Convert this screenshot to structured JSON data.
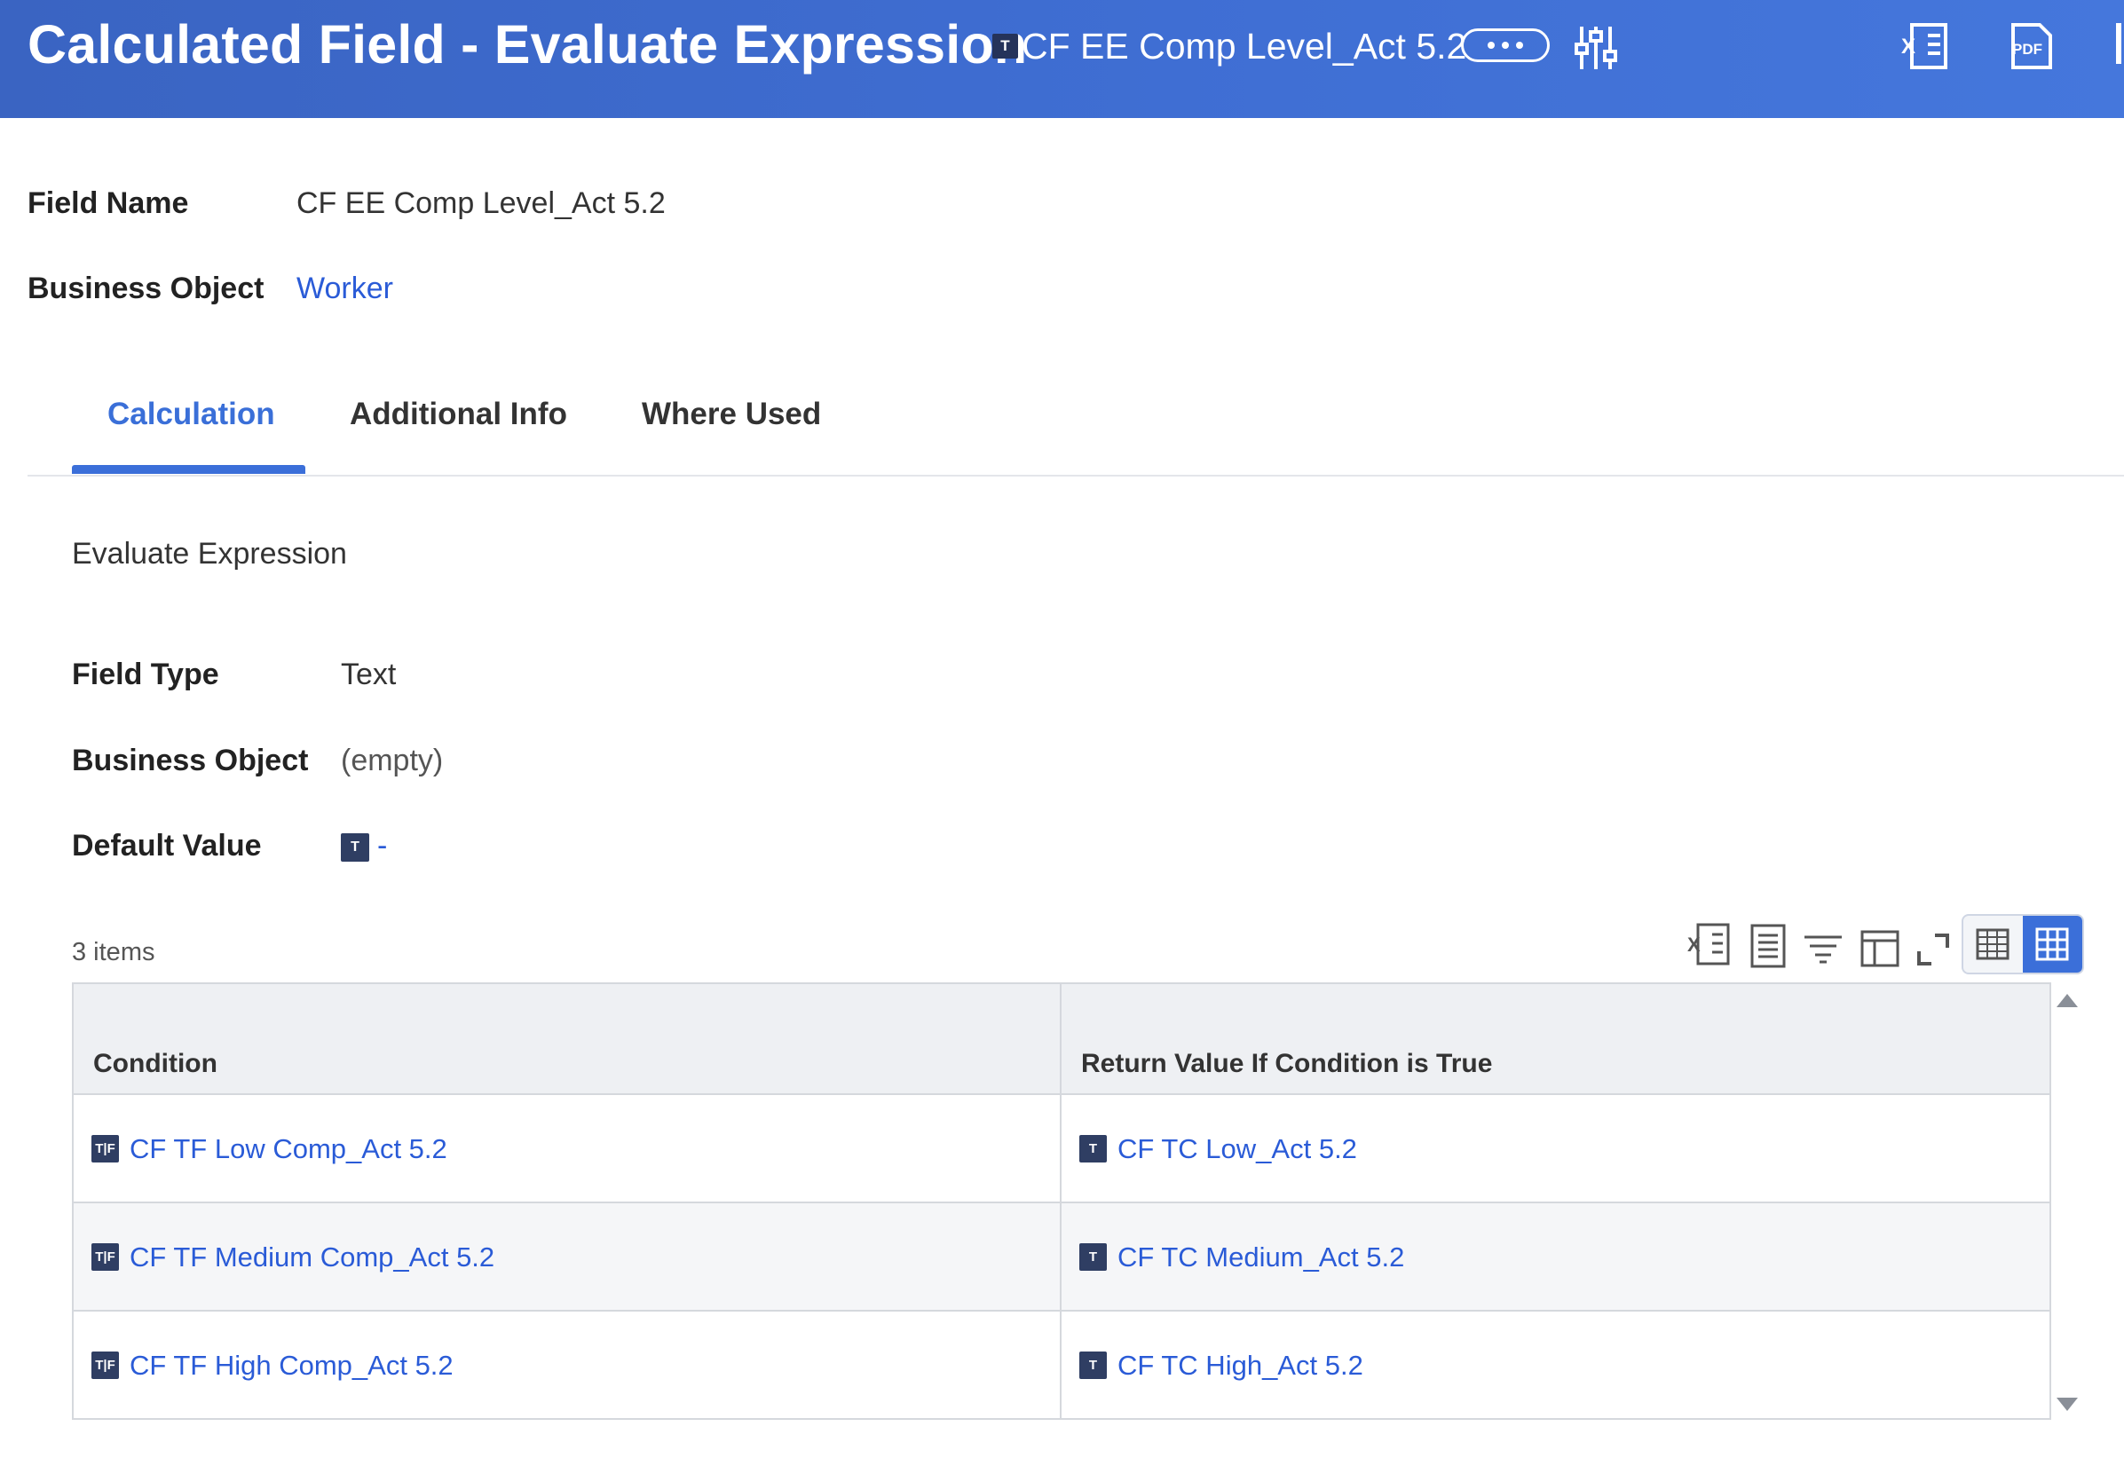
{
  "header": {
    "title": "Calculated Field - Evaluate Expression",
    "type_badge": "T",
    "field_name": "CF EE Comp Level_Act 5.2"
  },
  "fields": {
    "field_name_label": "Field Name",
    "field_name_value": "CF EE Comp Level_Act 5.2",
    "business_object_label": "Business Object",
    "business_object_value": "Worker"
  },
  "tabs": [
    {
      "label": "Calculation",
      "active": true
    },
    {
      "label": "Additional Info",
      "active": false
    },
    {
      "label": "Where Used",
      "active": false
    }
  ],
  "calculation": {
    "section_title": "Evaluate Expression",
    "field_type_label": "Field Type",
    "field_type_value": "Text",
    "business_object_label": "Business Object",
    "business_object_value": "(empty)",
    "default_value_label": "Default Value",
    "default_value_badge": "T",
    "default_value_value": "-"
  },
  "table": {
    "item_count": "3 items",
    "columns": [
      "Condition",
      "Return Value If Condition is True"
    ],
    "rows": [
      {
        "condition_badge": "T|F",
        "condition": "CF TF Low Comp_Act 5.2",
        "return_badge": "T",
        "return_value": "CF TC Low_Act 5.2"
      },
      {
        "condition_badge": "T|F",
        "condition": "CF TF Medium Comp_Act 5.2",
        "return_badge": "T",
        "return_value": "CF TC Medium_Act 5.2"
      },
      {
        "condition_badge": "T|F",
        "condition": "CF TF High Comp_Act 5.2",
        "return_badge": "T",
        "return_value": "CF TC High_Act 5.2"
      }
    ]
  },
  "icons": {
    "header": [
      "more-icon",
      "related-actions-icon",
      "excel-export-icon",
      "pdf-export-icon"
    ],
    "toolbar": [
      "excel-export-icon",
      "print-view-icon",
      "filter-icon",
      "column-layout-icon",
      "fullscreen-icon",
      "table-view-icon",
      "grid-view-icon"
    ]
  },
  "colors": {
    "header_bg": "#3f6ed3",
    "accent": "#3b6fd9",
    "link": "#2a5bd7",
    "badge": "#2f3e63"
  }
}
